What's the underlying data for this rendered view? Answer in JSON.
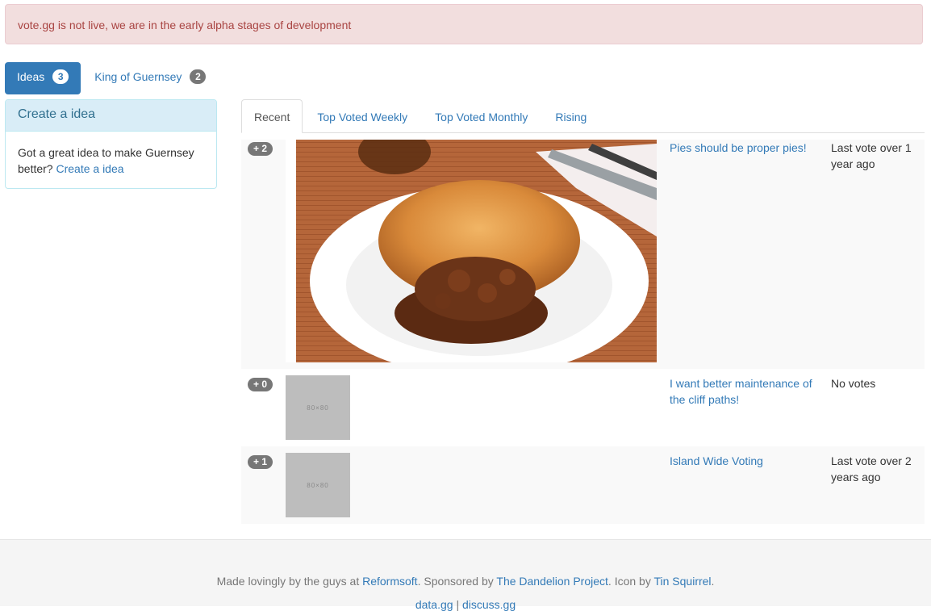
{
  "alert": {
    "text": "vote.gg is not live, we are in the early alpha stages of development"
  },
  "nav_pills": [
    {
      "label": "Ideas",
      "count": "3",
      "active": true
    },
    {
      "label": "King of Guernsey",
      "count": "2",
      "active": false
    }
  ],
  "panel": {
    "heading": "Create a idea",
    "body_text": "Got a great idea to make Guernsey better?",
    "link_text": "Create a idea"
  },
  "tabs": [
    {
      "label": "Recent",
      "active": true
    },
    {
      "label": "Top Voted Weekly",
      "active": false
    },
    {
      "label": "Top Voted Monthly",
      "active": false
    },
    {
      "label": "Rising",
      "active": false
    }
  ],
  "ideas": [
    {
      "votes": "+ 2",
      "title": "Pies should be proper pies!",
      "status": "Last vote over 1 year ago",
      "image": "pie-photo"
    },
    {
      "votes": "+ 0",
      "title": "I want better maintenance of the cliff paths!",
      "status": "No votes",
      "image": "placeholder",
      "placeholder_text": "80×80"
    },
    {
      "votes": "+ 1",
      "title": "Island Wide Voting",
      "status": "Last vote over 2 years ago",
      "image": "placeholder",
      "placeholder_text": "80×80"
    }
  ],
  "footer": {
    "prefix": "Made lovingly by the guys at",
    "reformsoft": "Reformsoft",
    "sponsored": ". Sponsored by",
    "dandelion": "The Dandelion Project",
    "icon_by": ". Icon by",
    "tin_squirrel": "Tin Squirrel",
    "period": ".",
    "data_gg": "data.gg",
    "separator": "|",
    "discuss_gg": "discuss.gg"
  },
  "colors": {
    "primary": "#337ab7",
    "alert_bg": "#f2dede",
    "alert_text": "#a94442",
    "info_bg": "#d9edf7",
    "info_text": "#31708f",
    "badge_gray": "#777777"
  }
}
